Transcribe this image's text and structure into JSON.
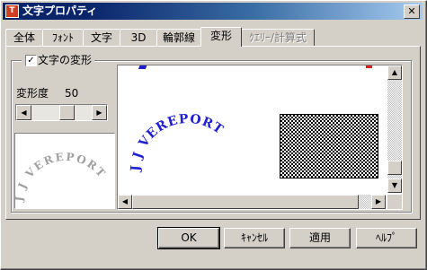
{
  "window": {
    "title": "文字プロパティ",
    "icon": "app-icon",
    "icon_text": "T",
    "close_label": "✕"
  },
  "tabs": [
    {
      "label": "全体"
    },
    {
      "label": "ﾌｫﾝﾄ"
    },
    {
      "label": "文字"
    },
    {
      "label": "3D"
    },
    {
      "label": "輪郭線"
    },
    {
      "label": "変形",
      "active": true
    },
    {
      "label": "ｸｴﾘｰ/計算式",
      "disabled": true
    }
  ],
  "transform": {
    "checkbox_label": "文字の変形",
    "checked": true,
    "check_mark": "✓",
    "degree_label": "変形度",
    "degree_value": "50",
    "slider_left": "◀",
    "slider_right": "▶"
  },
  "preview": {
    "arc_text": "J J VEREPORT",
    "canvas_arc_text": "J J VEREPORT",
    "arc_color": "#a0a0a0",
    "canvas_arc_color": "#2020d0",
    "scroll_up": "▲",
    "scroll_down": "▼",
    "scroll_left": "◀",
    "scroll_right": "▶"
  },
  "buttons": {
    "ok": "OK",
    "cancel": "ｷｬﾝｾﾙ",
    "apply": "適用",
    "help": "ﾍﾙﾌﾟ"
  }
}
